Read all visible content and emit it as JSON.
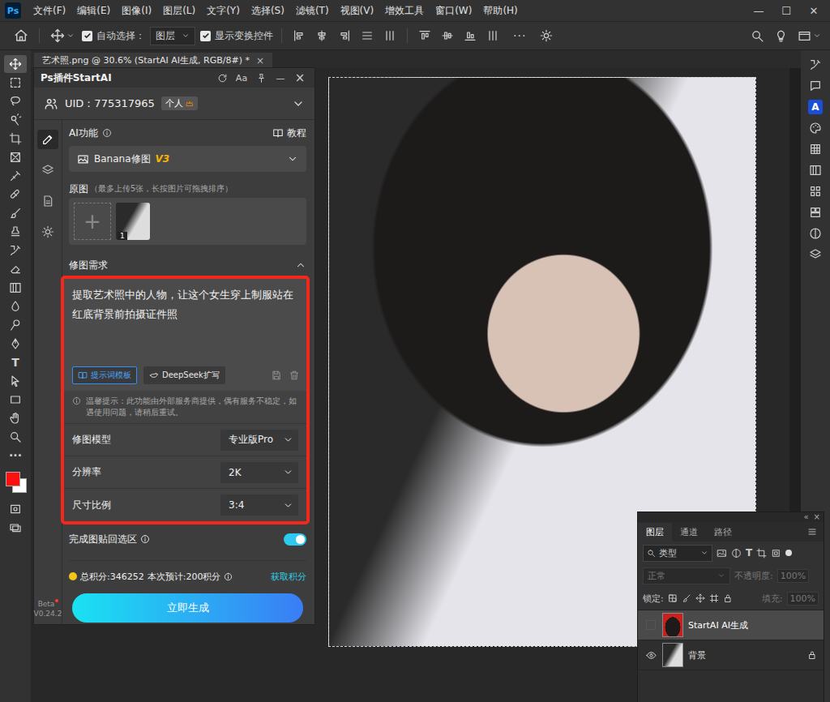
{
  "app": {
    "logo": "Ps"
  },
  "menu": [
    "文件(F)",
    "编辑(E)",
    "图像(I)",
    "图层(L)",
    "文字(Y)",
    "选择(S)",
    "滤镜(T)",
    "视图(V)",
    "增效工具",
    "窗口(W)",
    "帮助(H)"
  ],
  "window_controls": [
    "—",
    "☐",
    "✕"
  ],
  "options_bar": {
    "auto_select": {
      "label": "自动选择：",
      "checked": true
    },
    "target": "图层",
    "show_transform": {
      "label": "显示变换控件",
      "checked": true
    },
    "more": "···"
  },
  "document_tab": {
    "title": "艺术照.png @ 30.6% (StartAI AI生成, RGB/8#) *",
    "close": "×"
  },
  "toolbar": {
    "tools": [
      {
        "kind": "move",
        "selected": true
      },
      {
        "kind": "marquee",
        "selected": false
      },
      {
        "kind": "lasso",
        "selected": false
      },
      {
        "kind": "quick",
        "selected": false
      },
      {
        "kind": "crop",
        "selected": false
      },
      {
        "kind": "frame",
        "selected": false
      },
      {
        "kind": "eyedropper",
        "selected": false
      },
      {
        "kind": "healing",
        "selected": false
      },
      {
        "kind": "brush",
        "selected": false
      },
      {
        "kind": "stamp",
        "selected": false
      },
      {
        "kind": "history",
        "selected": false
      },
      {
        "kind": "eraser",
        "selected": false
      },
      {
        "kind": "gradient",
        "selected": false
      },
      {
        "kind": "blur",
        "selected": false
      },
      {
        "kind": "dodge",
        "selected": false
      },
      {
        "kind": "pen",
        "selected": false
      },
      {
        "kind": "text",
        "glyph": "T",
        "selected": false
      },
      {
        "kind": "pathsel",
        "selected": false
      },
      {
        "kind": "rect",
        "selected": false
      },
      {
        "kind": "hand",
        "selected": false
      },
      {
        "kind": "zoom",
        "selected": false
      },
      {
        "kind": "more",
        "glyph": "···",
        "selected": false
      }
    ],
    "swatches": [
      {
        "kind": "foreground",
        "color": "#ff1010"
      },
      {
        "kind": "background",
        "color": "#ffffff"
      }
    ],
    "extras": [
      {
        "kind": "quickmask"
      },
      {
        "kind": "screen"
      }
    ]
  },
  "right_strip": [
    {
      "kind": "history"
    },
    {
      "kind": "comment"
    },
    {
      "kind": "startai",
      "glyph": "A"
    },
    {
      "kind": "palette"
    },
    {
      "kind": "grid"
    },
    {
      "kind": "gradient"
    },
    {
      "kind": "swatchgrid"
    },
    {
      "kind": "library"
    },
    {
      "kind": "adjust"
    },
    {
      "kind": "layers"
    }
  ],
  "plugin": {
    "title": "Ps插件StartAI",
    "header_buttons": [
      "Aa",
      "—",
      "×"
    ],
    "uid": "UID：775317965",
    "account_badge": "个人",
    "side_tabs": [
      {
        "kind": "edit",
        "selected": true
      },
      {
        "kind": "layers",
        "selected": false
      },
      {
        "kind": "doc",
        "selected": false
      },
      {
        "kind": "gear",
        "selected": false
      }
    ],
    "ai_function": "AI功能",
    "tutorial": "教程",
    "function_select": {
      "name": "Banana修图",
      "version": "V3"
    },
    "source": {
      "label": "原图",
      "hint": "（最多上传5张，长按图片可拖拽排序）",
      "add": "+",
      "images": [
        {
          "index": "1"
        }
      ]
    },
    "request": {
      "label": "修图需求",
      "expanded": true,
      "text": "提取艺术照中的人物，让这个女生穿上制服站在红底背景前拍摄证件照",
      "template": "提示词模板",
      "expand": "DeepSeek扩写",
      "notice": "温馨提示：此功能由外部服务商提供，偶有服务不稳定，如遇使用问题，请稍后重试。"
    },
    "settings": [
      {
        "label": "修图模型",
        "value": "专业版Pro"
      },
      {
        "label": "分辨率",
        "value": "2K"
      },
      {
        "label": "尺寸比例",
        "value": "3:4"
      }
    ],
    "paste_back": {
      "label": "完成图贴回选区",
      "on": true
    },
    "points": {
      "total": "总积分:346252",
      "estimate": "本次预计:200积分",
      "get": "获取积分"
    },
    "generate": "立即生成",
    "version": {
      "beta": "Beta",
      "number": "V0.24.2"
    }
  },
  "layers_panel": {
    "top_buttons": [
      "«",
      "×"
    ],
    "tabs": [
      {
        "label": "图层",
        "selected": true
      },
      {
        "label": "通道",
        "selected": false
      },
      {
        "label": "路径",
        "selected": false
      }
    ],
    "filter": "类型",
    "filter_icons": [
      {
        "kind": "image"
      },
      {
        "kind": "halfcircle"
      },
      {
        "kind": "textglyph",
        "glyph": "T"
      },
      {
        "kind": "crop"
      },
      {
        "kind": "smart"
      }
    ],
    "blend": {
      "value": "正常",
      "disabled": true
    },
    "opacity": {
      "label": "不透明度:",
      "value": "100%",
      "disabled": true
    },
    "lock_label": "锁定:",
    "fill": {
      "label": "填充:",
      "value": "100%",
      "disabled": true
    },
    "layers": [
      {
        "name": "StartAI AI生成",
        "selected": true,
        "visible": false,
        "locked": false
      },
      {
        "name": "背景",
        "selected": false,
        "visible": true,
        "locked": true
      }
    ]
  }
}
